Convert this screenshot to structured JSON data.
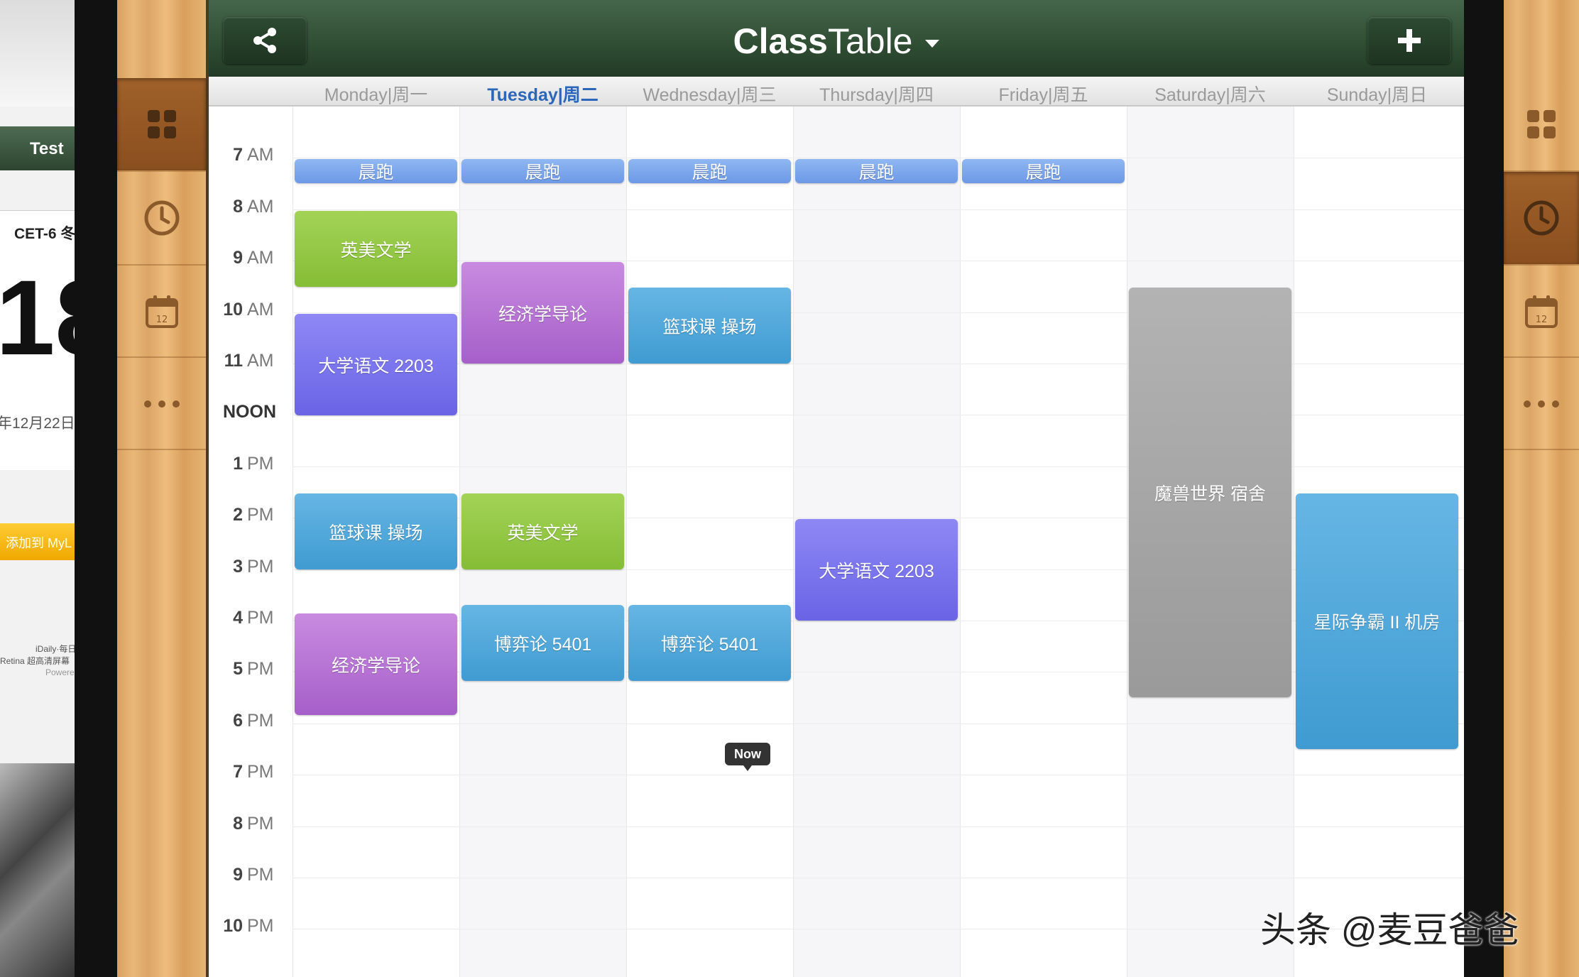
{
  "left_app": {
    "tab_label": "Test",
    "card_title": "CET-6 冬",
    "big_number": "18",
    "date_text": "年12月22日",
    "banner": "添加到 MyL",
    "footer_line1": "iDaily·每日",
    "footer_line2": "Retina 超高清屏幕",
    "footer_line3": "Powere"
  },
  "header": {
    "title_bold": "Class",
    "title_light": "Table"
  },
  "days": [
    {
      "label": "Monday|周一",
      "today": false
    },
    {
      "label": "Tuesday|周二",
      "today": true
    },
    {
      "label": "Wednesday|周三",
      "today": false
    },
    {
      "label": "Thursday|周四",
      "today": false
    },
    {
      "label": "Friday|周五",
      "today": false
    },
    {
      "label": "Saturday|周六",
      "today": false
    },
    {
      "label": "Sunday|周日",
      "today": false
    }
  ],
  "times": [
    {
      "num": "7",
      "suffix": "AM"
    },
    {
      "num": "8",
      "suffix": "AM"
    },
    {
      "num": "9",
      "suffix": "AM"
    },
    {
      "num": "10",
      "suffix": "AM"
    },
    {
      "num": "11",
      "suffix": "AM"
    },
    {
      "num": "",
      "suffix": "NOON"
    },
    {
      "num": "1",
      "suffix": "PM"
    },
    {
      "num": "2",
      "suffix": "PM"
    },
    {
      "num": "3",
      "suffix": "PM"
    },
    {
      "num": "4",
      "suffix": "PM"
    },
    {
      "num": "5",
      "suffix": "PM"
    },
    {
      "num": "6",
      "suffix": "PM"
    },
    {
      "num": "7",
      "suffix": "PM"
    },
    {
      "num": "8",
      "suffix": "PM"
    },
    {
      "num": "9",
      "suffix": "PM"
    },
    {
      "num": "10",
      "suffix": "PM"
    }
  ],
  "events": [
    {
      "day": 0,
      "start": 7.0,
      "end": 7.5,
      "title": "晨跑",
      "color": "blue-light"
    },
    {
      "day": 1,
      "start": 7.0,
      "end": 7.5,
      "title": "晨跑",
      "color": "blue-light"
    },
    {
      "day": 2,
      "start": 7.0,
      "end": 7.5,
      "title": "晨跑",
      "color": "blue-light"
    },
    {
      "day": 3,
      "start": 7.0,
      "end": 7.5,
      "title": "晨跑",
      "color": "blue-light"
    },
    {
      "day": 4,
      "start": 7.0,
      "end": 7.5,
      "title": "晨跑",
      "color": "blue-light"
    },
    {
      "day": 0,
      "start": 8.0,
      "end": 9.5,
      "title": "英美文学",
      "color": "green"
    },
    {
      "day": 0,
      "start": 10.0,
      "end": 12.0,
      "title": "大学语文 2203",
      "color": "indigo"
    },
    {
      "day": 1,
      "start": 9.0,
      "end": 11.0,
      "title": "经济学导论",
      "color": "purple"
    },
    {
      "day": 2,
      "start": 9.5,
      "end": 11.0,
      "title": "篮球课 操场",
      "color": "cyan"
    },
    {
      "day": 0,
      "start": 13.5,
      "end": 15.0,
      "title": "篮球课 操场",
      "color": "cyan"
    },
    {
      "day": 1,
      "start": 13.5,
      "end": 15.0,
      "title": "英美文学",
      "color": "green"
    },
    {
      "day": 3,
      "start": 14.0,
      "end": 16.0,
      "title": "大学语文 2203",
      "color": "indigo"
    },
    {
      "day": 0,
      "start": 15.83,
      "end": 17.83,
      "title": "经济学导论",
      "color": "purple"
    },
    {
      "day": 1,
      "start": 15.67,
      "end": 17.17,
      "title": "博弈论 5401",
      "color": "cyan"
    },
    {
      "day": 2,
      "start": 15.67,
      "end": 17.17,
      "title": "博弈论 5401",
      "color": "cyan"
    },
    {
      "day": 5,
      "start": 9.5,
      "end": 17.5,
      "title": "魔兽世界 宿舍",
      "color": "gray"
    },
    {
      "day": 6,
      "start": 13.5,
      "end": 18.5,
      "title": "星际争霸 II 机房",
      "color": "cyan"
    }
  ],
  "now_label": "Now",
  "calendar_icon_number": "12",
  "watermark": "头条 @麦豆爸爸",
  "colors": {
    "header_green": "#2f4d33",
    "today_blue": "#2b66b8",
    "wood": "#e0ac6b"
  }
}
